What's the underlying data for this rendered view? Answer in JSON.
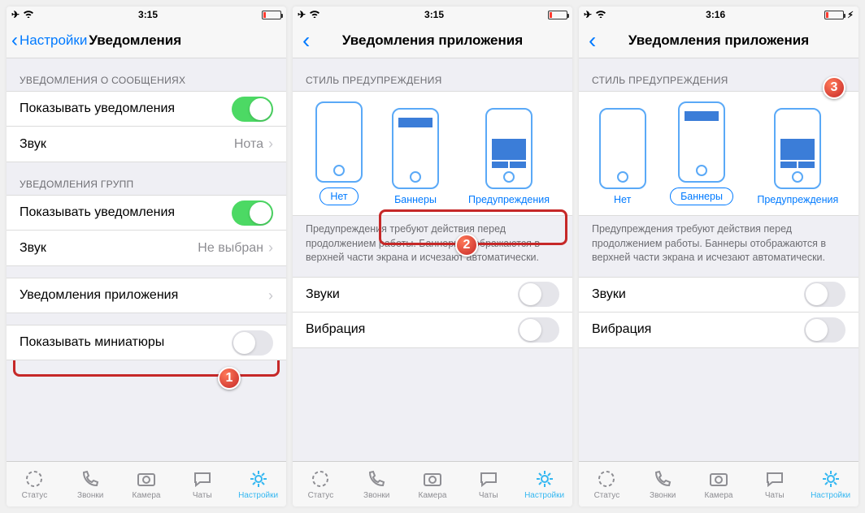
{
  "status": {
    "time1": "3:15",
    "time2": "3:15",
    "time3": "3:16"
  },
  "screen1": {
    "back": "Настройки",
    "title": "Уведомления",
    "sec1": "УВЕДОМЛЕНИЯ О СООБЩЕНИЯХ",
    "show_notif": "Показывать уведомления",
    "sound": "Звук",
    "sound_val": "Нота",
    "sec2": "УВЕДОМЛЕНИЯ ГРУПП",
    "sound_val2": "Не выбран",
    "app_notif": "Уведомления приложения",
    "thumbs": "Показывать миниатюры"
  },
  "screen23": {
    "title": "Уведомления приложения",
    "sec": "СТИЛЬ ПРЕДУПРЕЖДЕНИЯ",
    "none": "Нет",
    "banners": "Баннеры",
    "alerts": "Предупреждения",
    "desc": "Предупреждения требуют действия перед продолжением работы. Баннеры отображаются в верхней части экрана и исчезают автоматически.",
    "sounds": "Звуки",
    "vibration": "Вибрация"
  },
  "tabs": {
    "status": "Статус",
    "calls": "Звонки",
    "camera": "Камера",
    "chats": "Чаты",
    "settings": "Настройки"
  },
  "badges": {
    "b1": "1",
    "b2": "2",
    "b3": "3"
  }
}
